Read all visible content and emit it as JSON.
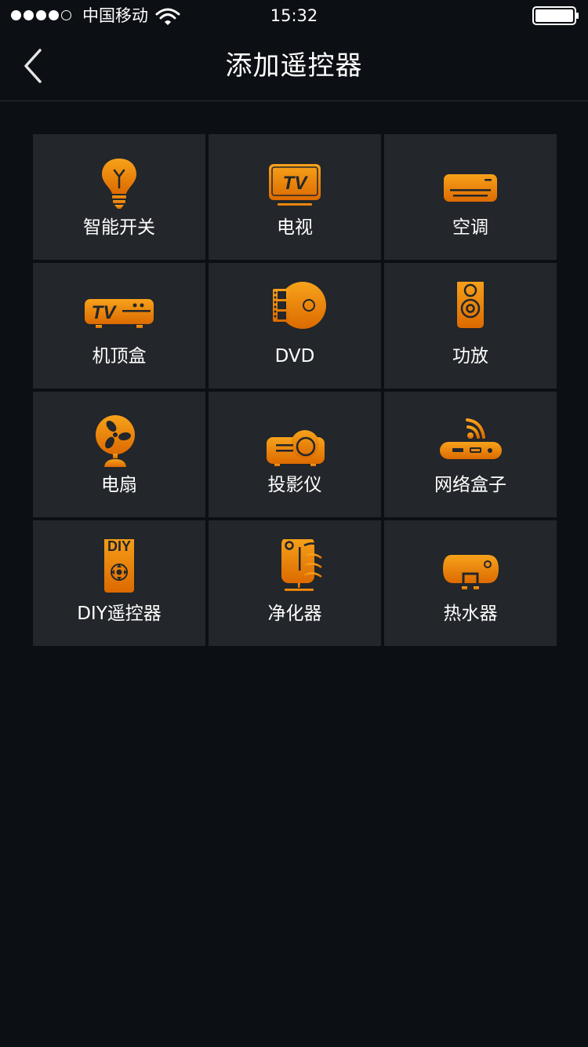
{
  "status_bar": {
    "carrier": "中国移动",
    "time": "15:32",
    "signal_bars": 4,
    "signal_total": 5
  },
  "nav": {
    "title": "添加遥控器",
    "back_icon": "chevron-left-icon"
  },
  "colors": {
    "accent": "#f29500",
    "tile_bg": "#23262a",
    "page_bg": "#0c0f13"
  },
  "devices": [
    {
      "label": "智能开关",
      "icon": "light-bulb-icon"
    },
    {
      "label": "电视",
      "icon": "tv-icon"
    },
    {
      "label": "空调",
      "icon": "air-conditioner-icon"
    },
    {
      "label": "机顶盒",
      "icon": "set-top-box-icon"
    },
    {
      "label": "DVD",
      "icon": "dvd-icon"
    },
    {
      "label": "功放",
      "icon": "speaker-icon"
    },
    {
      "label": "电扇",
      "icon": "fan-icon"
    },
    {
      "label": "投影仪",
      "icon": "projector-icon"
    },
    {
      "label": "网络盒子",
      "icon": "network-box-icon"
    },
    {
      "label": "DIY遥控器",
      "icon": "diy-remote-icon",
      "icon_text": "DIY"
    },
    {
      "label": "净化器",
      "icon": "air-purifier-icon"
    },
    {
      "label": "热水器",
      "icon": "water-heater-icon"
    }
  ]
}
